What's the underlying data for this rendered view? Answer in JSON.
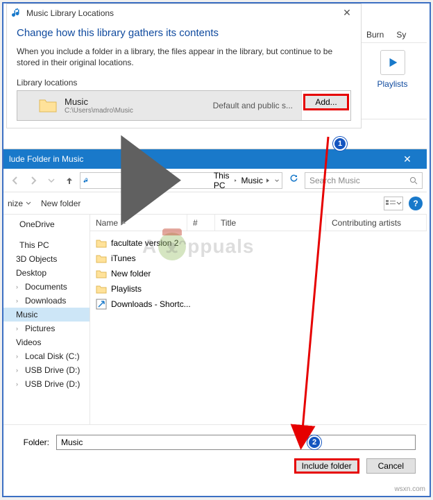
{
  "dlg1": {
    "title": "Music Library Locations",
    "heading": "Change how this library gathers its contents",
    "desc": "When you include a folder in a library, the files appear in the library, but continue to be stored in their original locations.",
    "section": "Library locations",
    "row": {
      "name": "Music",
      "path": "C:\\Users\\madro\\Music",
      "default": "Default and public s..."
    },
    "add": "Add..."
  },
  "peek": {
    "burn": "Burn",
    "sy": "Sy",
    "playlists": "Playlists"
  },
  "dlg2": {
    "title": "lude Folder in Music",
    "nav_up": "↑",
    "crumbs": [
      "This PC",
      "Music"
    ],
    "search_ph": "Search Music",
    "toolbar": {
      "organize": "nize",
      "newfolder": "New folder"
    },
    "cols": {
      "name": "Name",
      "num": "#",
      "title": "Title",
      "art": "Contributing artists"
    },
    "tree": {
      "onedrive": "OneDrive",
      "thispc": "This PC",
      "items": [
        "3D Objects",
        "Desktop",
        "Documents",
        "Downloads",
        "Music",
        "Pictures",
        "Videos",
        "Local Disk (C:)",
        "USB Drive (D:)",
        "USB Drive (D:)"
      ]
    },
    "files": [
      "facultate version 2",
      "iTunes",
      "New folder",
      "Playlists",
      "Downloads - Shortc..."
    ],
    "folder_label": "Folder:",
    "folder_value": "Music",
    "include": "Include folder",
    "cancel": "Cancel"
  },
  "badges": {
    "b1": "1",
    "b2": "2"
  },
  "watermark": {
    "a": "A",
    "ppuals": "ppuals"
  },
  "wsxn": "wsxn.com"
}
